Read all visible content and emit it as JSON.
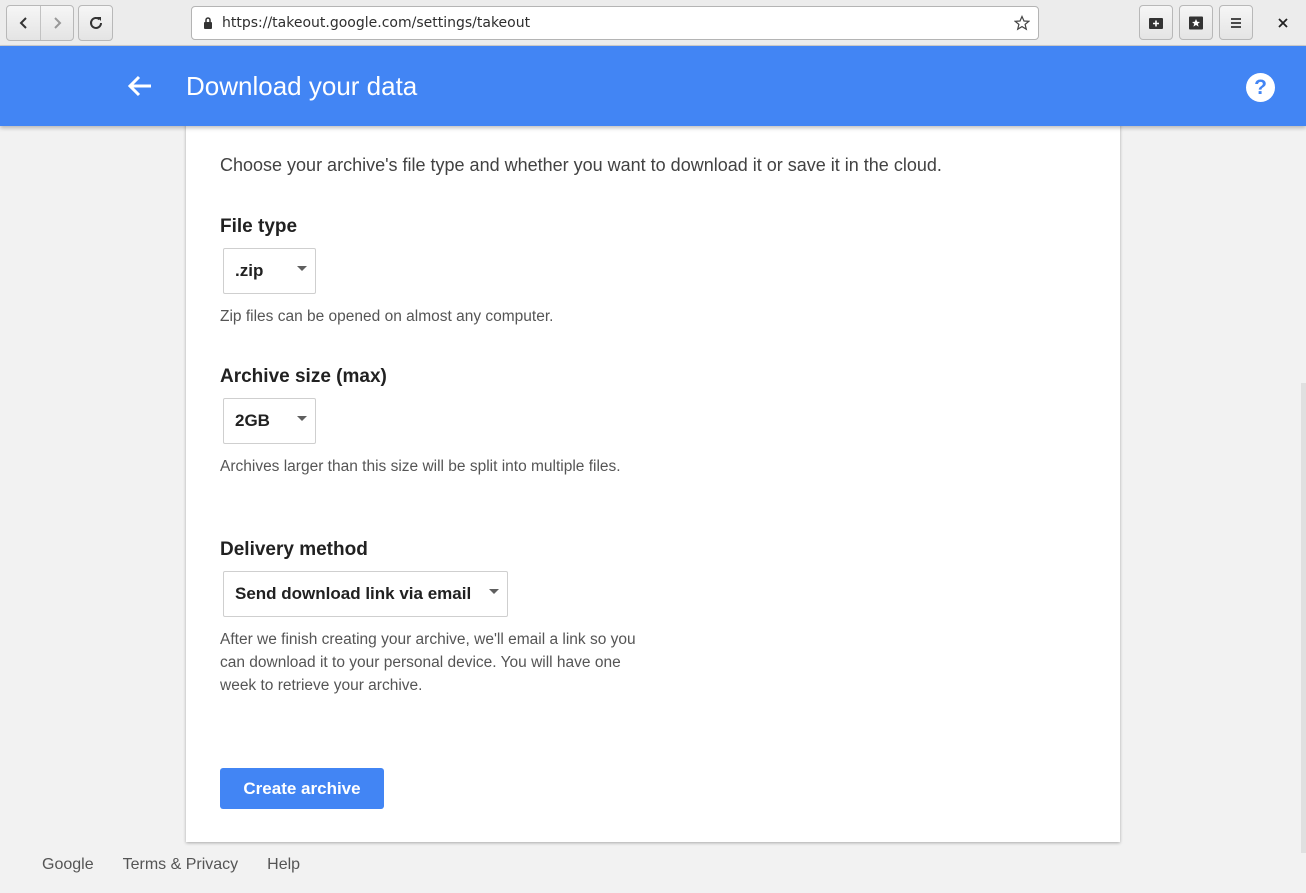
{
  "browser": {
    "url": "https://takeout.google.com/settings/takeout",
    "icons": [
      "back-arrow-icon",
      "forward-arrow-icon",
      "reload-icon",
      "lock-icon",
      "bookmark-star-icon",
      "new-tab-icon",
      "bookmarks-icon",
      "menu-icon",
      "close-icon"
    ]
  },
  "appbar": {
    "title": "Download your data",
    "help_label": "?",
    "color": "#4285f4"
  },
  "card": {
    "intro": "Choose your archive's file type and whether you want to download it or save it in the cloud.",
    "file_type": {
      "title": "File type",
      "selected": ".zip",
      "description": "Zip files can be opened on almost any computer."
    },
    "archive_size": {
      "title": "Archive size (max)",
      "selected": "2GB",
      "description": "Archives larger than this size will be split into multiple files."
    },
    "delivery": {
      "title": "Delivery method",
      "selected": "Send download link via email",
      "description": "After we finish creating your archive, we'll email a link so you can download it to your personal device. You will have one week to retrieve your archive."
    },
    "create_button": "Create archive"
  },
  "footer": {
    "links": [
      "Google",
      "Terms & Privacy",
      "Help"
    ]
  }
}
